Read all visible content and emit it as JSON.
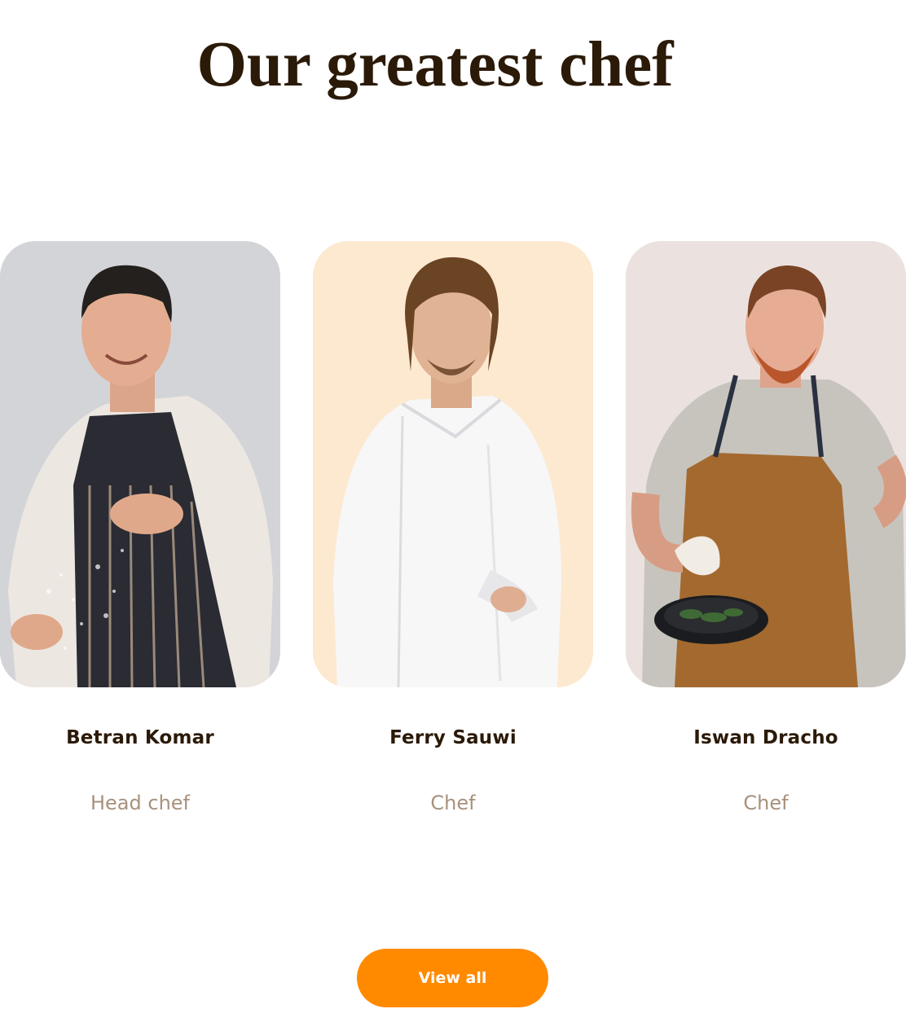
{
  "section": {
    "title": "Our greatest chef"
  },
  "chefs": [
    {
      "name": "Betran Komar",
      "role": "Head chef",
      "photo_bg": "#d3d4d8",
      "photo_alt": "chef-photo"
    },
    {
      "name": "Ferry Sauwi",
      "role": "Chef",
      "photo_bg": "#fde9d0",
      "photo_alt": "chef-photo"
    },
    {
      "name": "Iswan Dracho",
      "role": "Chef",
      "photo_bg": "#ebe2df",
      "photo_alt": "chef-photo"
    }
  ],
  "actions": {
    "view_all_label": "View all"
  },
  "colors": {
    "heading": "#2b1a08",
    "role_text": "#a8917c",
    "accent": "#ff8a00"
  }
}
